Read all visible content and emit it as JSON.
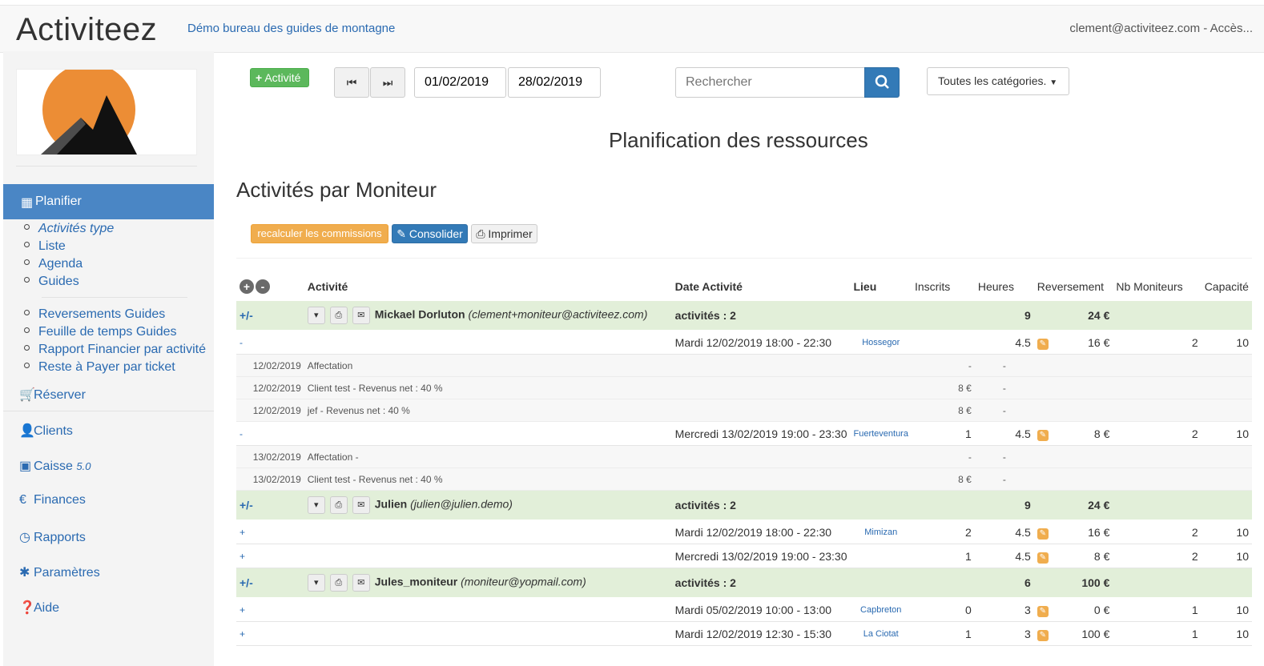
{
  "header": {
    "brand": "Activiteez",
    "org": "Démo bureau des guides de montagne",
    "user": "clement@activiteez.com - Accès..."
  },
  "sidebar": {
    "active_label": "Planifier",
    "sub1": [
      "Activités type",
      "Liste",
      "Agenda",
      "Guides"
    ],
    "sub2": [
      "Reversements Guides",
      "Feuille de temps Guides",
      "Rapport Financier par activité",
      "Reste à Payer par ticket"
    ],
    "reserver": "Réserver",
    "clients": "Clients",
    "caisse": "Caisse",
    "caisse_version": "5.0",
    "finances": "Finances",
    "rapports": "Rapports",
    "parametres": "Paramètres",
    "aide": "Aide"
  },
  "toolbar": {
    "add_label": "Activité",
    "date_from": "01/02/2019",
    "date_to": "28/02/2019",
    "search_placeholder": "Rechercher",
    "category_label": "Toutes les catégories."
  },
  "page": {
    "title": "Planification des ressources",
    "subtitle": "Activités par Moniteur"
  },
  "actions": {
    "recalc": "recalculer les commissions",
    "consolidate": "Consolider",
    "print": "Imprimer"
  },
  "table": {
    "headers": {
      "activite": "Activité",
      "date": "Date Activité",
      "lieu": "Lieu",
      "inscrits": "Inscrits",
      "heures": "Heures",
      "reversement": "Reversement",
      "nb": "Nb Moniteurs",
      "capacite": "Capacité"
    },
    "groups": [
      {
        "toggle": "+/-",
        "name": "Mickael Dorluton",
        "email": "(clement+moniteur@activiteez.com)",
        "count": "activités : 2",
        "heures": "9",
        "reversement": "24 €",
        "rows": [
          {
            "toggle": "-",
            "date": "Mardi 12/02/2019 18:00 - 22:30",
            "lieu": "Hossegor",
            "inscrits": "",
            "heures": "4.5",
            "reversement": "16 €",
            "nb": "2",
            "capacite": "10",
            "details": [
              {
                "date": "12/02/2019",
                "label": "Affectation",
                "amount": "-",
                "h": "-"
              },
              {
                "date": "12/02/2019",
                "label": "Client test - Revenus net : 40 %",
                "amount": "8 €",
                "h": "-"
              },
              {
                "date": "12/02/2019",
                "label": "jef - Revenus net : 40 %",
                "amount": "8 €",
                "h": "-"
              }
            ]
          },
          {
            "toggle": "-",
            "date": "Mercredi 13/02/2019 19:00 - 23:30",
            "lieu": "Fuerteventura",
            "inscrits": "1",
            "heures": "4.5",
            "reversement": "8 €",
            "nb": "2",
            "capacite": "10",
            "details": [
              {
                "date": "13/02/2019",
                "label": "Affectation -",
                "amount": "-",
                "h": "-"
              },
              {
                "date": "13/02/2019",
                "label": "Client test - Revenus net : 40 %",
                "amount": "8 €",
                "h": "-"
              }
            ]
          }
        ]
      },
      {
        "toggle": "+/-",
        "name": "Julien",
        "email": "(julien@julien.demo)",
        "count": "activités : 2",
        "heures": "9",
        "reversement": "24 €",
        "rows": [
          {
            "toggle": "+",
            "date": "Mardi 12/02/2019 18:00 - 22:30",
            "lieu": "Mimizan",
            "inscrits": "2",
            "heures": "4.5",
            "reversement": "16 €",
            "nb": "2",
            "capacite": "10",
            "details": []
          },
          {
            "toggle": "+",
            "date": "Mercredi 13/02/2019 19:00 - 23:30",
            "lieu": "",
            "inscrits": "1",
            "heures": "4.5",
            "reversement": "8 €",
            "nb": "2",
            "capacite": "10",
            "details": []
          }
        ]
      },
      {
        "toggle": "+/-",
        "name": "Jules_moniteur",
        "email": "(moniteur@yopmail.com)",
        "count": "activités : 2",
        "heures": "6",
        "reversement": "100 €",
        "rows": [
          {
            "toggle": "+",
            "date": "Mardi 05/02/2019 10:00 - 13:00",
            "lieu": "Capbreton",
            "inscrits": "0",
            "heures": "3",
            "reversement": "0 €",
            "nb": "1",
            "capacite": "10",
            "details": []
          },
          {
            "toggle": "+",
            "date": "Mardi 12/02/2019 12:30 - 15:30",
            "lieu": "La Ciotat",
            "inscrits": "1",
            "heures": "3",
            "reversement": "100 €",
            "nb": "1",
            "capacite": "10",
            "details": []
          }
        ]
      }
    ]
  }
}
